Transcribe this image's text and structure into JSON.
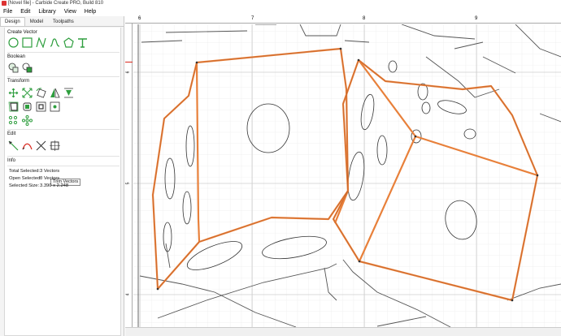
{
  "window": {
    "title": "[Novel file] - Carbide Create PRO, Build 810"
  },
  "menu": [
    "File",
    "Edit",
    "Library",
    "View",
    "Help"
  ],
  "tabs": [
    "Design",
    "Model",
    "Toolpaths"
  ],
  "sections": {
    "create_vector": "Create Vector",
    "boolean": "Boolean",
    "transform": "Transform",
    "edit": "Edit",
    "info": "Info"
  },
  "tooltip": "Trim Vectors",
  "info": {
    "total_selected_label": "Total Selected:",
    "total_selected_value": "3 Vectors",
    "open_selected_label": "Open Selected:",
    "open_selected_value": "0 Vectors",
    "selected_size_label": "Selected Size:",
    "selected_size_value": "3.390 x 2.248"
  },
  "ruler": {
    "h_labels": [
      "6",
      "7",
      "8",
      "9"
    ],
    "v_labels": [
      "6",
      "5",
      "4"
    ]
  },
  "colors": {
    "accent_green": "#2e9e3e",
    "selection_orange": "#e8803a",
    "ruler_marker_red": "#d9261c"
  }
}
